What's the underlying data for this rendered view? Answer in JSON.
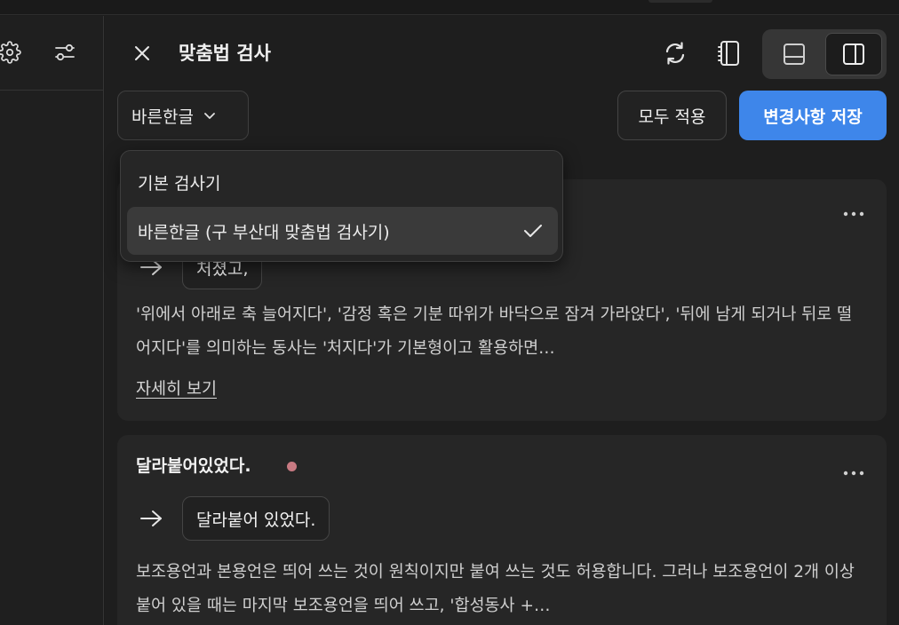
{
  "panel": {
    "title": "맞춤법 검사"
  },
  "toolbar": {
    "engine_selected": "바른한글",
    "apply_all_label": "모두 적용",
    "save_label": "변경사항 저장"
  },
  "dropdown": {
    "options": [
      {
        "label": "기본 검사기",
        "selected": false
      },
      {
        "label": "바른한글 (구 부산대 맞춤법 검사기)",
        "selected": true
      }
    ]
  },
  "corrections": [
    {
      "original": "",
      "suggestion": "처졌고,",
      "description": "'위에서 아래로 축 늘어지다', '감정 혹은 기분 따위가 바닥으로 잠겨 가라앉다', '뒤에 남게 되거나 뒤로 떨어지다'를 의미하는 동사는 '처지다'가 기본형이고 활용하면…",
      "more_label": "자세히 보기"
    },
    {
      "original": "달라붙어있었다.",
      "suggestion": "달라붙어 있었다.",
      "description": "보조용언과 본용언은 띄어 쓰는 것이 원칙이지만 붙여 쓰는 것도 허용합니다. 그러나 보조용언이 2개 이상 붙어 있을 때는 마지막 보조용언을 띄어 쓰고, '합성동사 +…",
      "more_label": ""
    }
  ],
  "icons": {
    "left": [
      "gear-icon",
      "sliders-icon"
    ],
    "header": [
      "close-icon",
      "refresh-icon",
      "notebook-icon",
      "layout-bottom-icon",
      "layout-side-icon"
    ],
    "row": [
      "chevron-down-icon",
      "arrow-right-icon",
      "more-icon",
      "check-icon"
    ]
  },
  "colors": {
    "accent": "#3e86ea",
    "error_dot": "#c87a82",
    "background": "#1e1e1e",
    "card": "#262626"
  }
}
